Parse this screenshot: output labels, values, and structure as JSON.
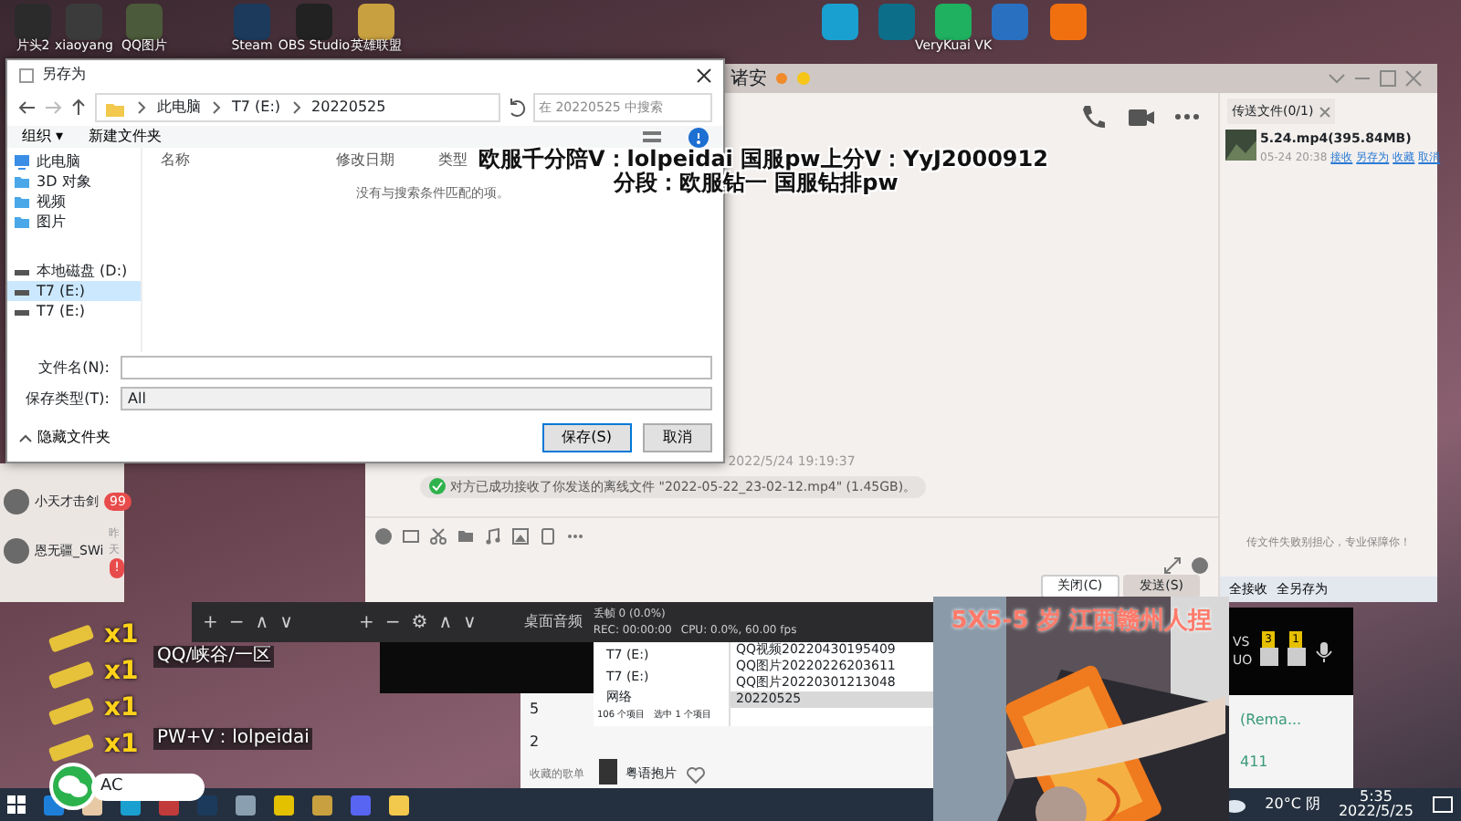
{
  "desktop_icons": [
    {
      "label": "片头2",
      "color": "#2b2b2b"
    },
    {
      "label": "xiaoyang",
      "color": "#3b3b3b"
    },
    {
      "label": "QQ图片",
      "color": "#4b5a3a"
    },
    {
      "label": "Steam",
      "color": "#1b3a5c"
    },
    {
      "label": "OBS Studio",
      "color": "#222222"
    },
    {
      "label": "英雄联盟",
      "color": "#c8a040"
    },
    {
      "color": "#1aa0d0"
    },
    {
      "color": "#0d6e8a"
    },
    {
      "label": "VeryKuai VK",
      "color": "#1fb060"
    },
    {
      "color": "#2a70c0"
    },
    {
      "color": "#f07010"
    }
  ],
  "save_dialog": {
    "title": "另存为",
    "path": [
      "此电脑",
      "T7 (E:)",
      "20220525"
    ],
    "search": {
      "placeholder": "在 20220525 中搜索"
    },
    "toolbar": [
      "组织 ▾",
      "新建文件夹"
    ],
    "nav": [
      {
        "label": "此电脑",
        "kind": "pc",
        "selected": false
      },
      {
        "label": "3D 对象",
        "kind": "folder",
        "selected": false
      },
      {
        "label": "视频",
        "kind": "folder",
        "selected": false
      },
      {
        "label": "图片",
        "kind": "folder",
        "selected": false
      },
      {
        "label": "本地磁盘 (D:)",
        "kind": "drive",
        "selected": false
      },
      {
        "label": "T7 (E:)",
        "kind": "drive",
        "selected": true
      },
      {
        "label": "T7 (E:)",
        "kind": "drive",
        "selected": false
      }
    ],
    "columns": [
      "名称",
      "修改日期",
      "类型"
    ],
    "empty_text": "没有与搜索条件匹配的项。",
    "filename_label": "文件名(N):",
    "type_label": "保存类型(T):",
    "type_value": "All",
    "hide_folders": "隐藏文件夹",
    "buttons": [
      "保存(S)",
      "取消"
    ]
  },
  "overlay_text": [
    "欧服千分陪V：lolpeidai 国服pw上分V：YyJ2000912",
    "分段：欧服钻一 国服钻排pw"
  ],
  "contacts": [
    {
      "name": "小天才击剑",
      "badge": "99"
    },
    {
      "name": "恩无疆_SWi",
      "time": "昨天",
      "badge": "!"
    }
  ],
  "chat": {
    "title": "诸安",
    "timestamp": "2022/5/24 19:19:37",
    "notice": "对方已成功接收了你发送的离线文件 \"2022-05-22_23-02-12.mp4\" (1.45GB)。",
    "buttons": [
      "关闭(C)",
      "发送(S)"
    ]
  },
  "transfer": {
    "tab": "传送文件(0/1)",
    "file": "5.24.mp4(395.84MB)",
    "time": "05-24 20:38",
    "actions": [
      "接收",
      "另存为",
      "收藏",
      "取消"
    ],
    "tip": "传文件失败别担心，专业保障你！",
    "footer": [
      "全接收",
      "全另存为"
    ]
  },
  "obs": {
    "controls": [
      "+",
      "−",
      "∧",
      "∨",
      "+",
      "−",
      "⚙",
      "∧",
      "∨"
    ],
    "source": "桌面音频",
    "stats": [
      "丢帧 0 (0.0%)",
      "REC: 00:00:00",
      "CPU: 0.0%, 60.00 fps"
    ]
  },
  "explorer": {
    "nav": [
      "T7 (E:)",
      "T7 (E:)",
      "网络"
    ],
    "files": [
      {
        "name": "QQ视频20220430195409",
        "selected": false
      },
      {
        "name": "QQ图片20220226203611",
        "selected": false
      },
      {
        "name": "QQ图片20220301213048",
        "selected": false
      },
      {
        "name": "20220525",
        "selected": true
      }
    ],
    "status": [
      "106 个项目",
      "选中 1 个项目"
    ]
  },
  "music": {
    "rows": [
      "5",
      "2"
    ],
    "section": "收藏的歌单",
    "song": "粤语抱片",
    "comments": "(Rema...",
    "count": "411"
  },
  "webcam": {
    "caption": "5X5-5 岁 江西赣州人捏"
  },
  "stream_panel": {
    "labels": [
      "VS",
      "UO"
    ],
    "badges": [
      "3",
      "1"
    ]
  },
  "gifts": [
    {
      "count": "x1"
    },
    {
      "count": "x1"
    },
    {
      "count": "x1"
    },
    {
      "count": "x1"
    }
  ],
  "desktop_labels": [
    "QQ/峡谷/一区",
    "PW+V：lolpeidai"
  ],
  "notification": {
    "text": "AC"
  },
  "taskbar": {
    "weather": "20°C 阴",
    "time": "5:35",
    "date": "2022/5/25"
  }
}
